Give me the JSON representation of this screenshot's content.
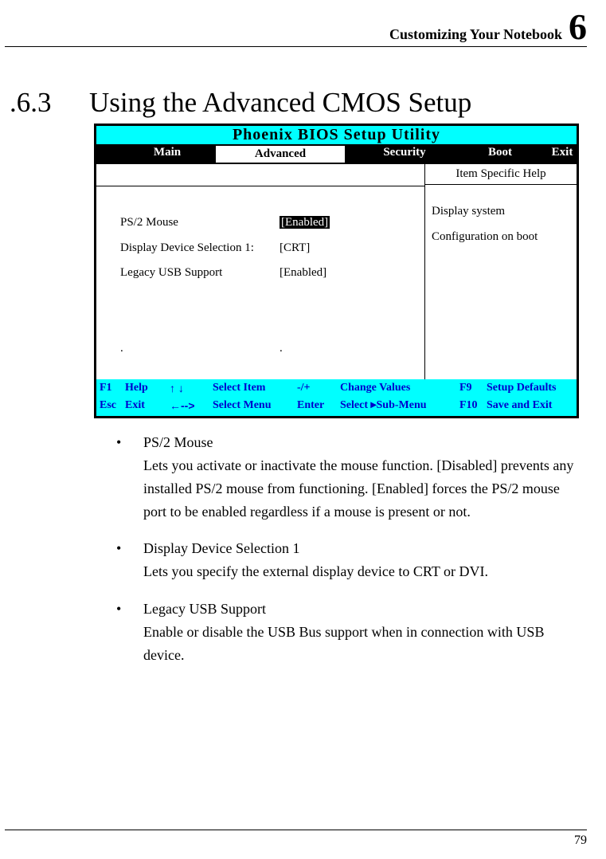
{
  "header": {
    "title": "Customizing Your Notebook",
    "chapter": "6"
  },
  "section": {
    "number": ".6.3",
    "title": "Using the Advanced CMOS Setup"
  },
  "bios": {
    "title": "Phoenix BIOS Setup Utility",
    "tabs": {
      "main": "Main",
      "advanced": "Advanced",
      "security": "Security",
      "boot": "Boot",
      "exit": "Exit"
    },
    "help_header": "Item Specific Help",
    "help_text_1": "Display system",
    "help_text_2": "Configuration on boot",
    "options": {
      "row1_label": "PS/2 Mouse",
      "row1_value": "[Enabled]",
      "row2_label": "Display Device Selection 1:",
      "row2_value": "[CRT]",
      "row3_label": "Legacy USB Support",
      "row3_value": "[Enabled]"
    },
    "footer": {
      "r1_k": "F1",
      "r1_l": "Help",
      "r1_a": "↑ ↓",
      "r1_s": "Select Item",
      "r1_pm": "-/+",
      "r1_cv": "Change Values",
      "r1_fk": "F9",
      "r1_fd": "Setup Defaults",
      "r2_k": "Esc",
      "r2_l": "Exit",
      "r2_a": "←-->",
      "r2_s": "Select Menu",
      "r2_pm": "Enter",
      "r2_cv": "Select  ▸Sub-Menu",
      "r2_fk": "F10",
      "r2_fd": "Save and Exit"
    }
  },
  "bullets": {
    "b1_head": "PS/2 Mouse",
    "b1_body": "Lets you activate or inactivate the mouse function. [Disabled] prevents any installed PS/2 mouse from functioning. [Enabled] forces the PS/2 mouse port to be enabled regardless if a mouse is present or not.",
    "b2_head": "Display Device Selection 1",
    "b2_body": "Lets you specify the external display device to CRT or DVI.",
    "b3_head": "Legacy USB Support",
    "b3_body": "Enable or disable the USB Bus support when in connection with USB device."
  },
  "page_number": "79"
}
